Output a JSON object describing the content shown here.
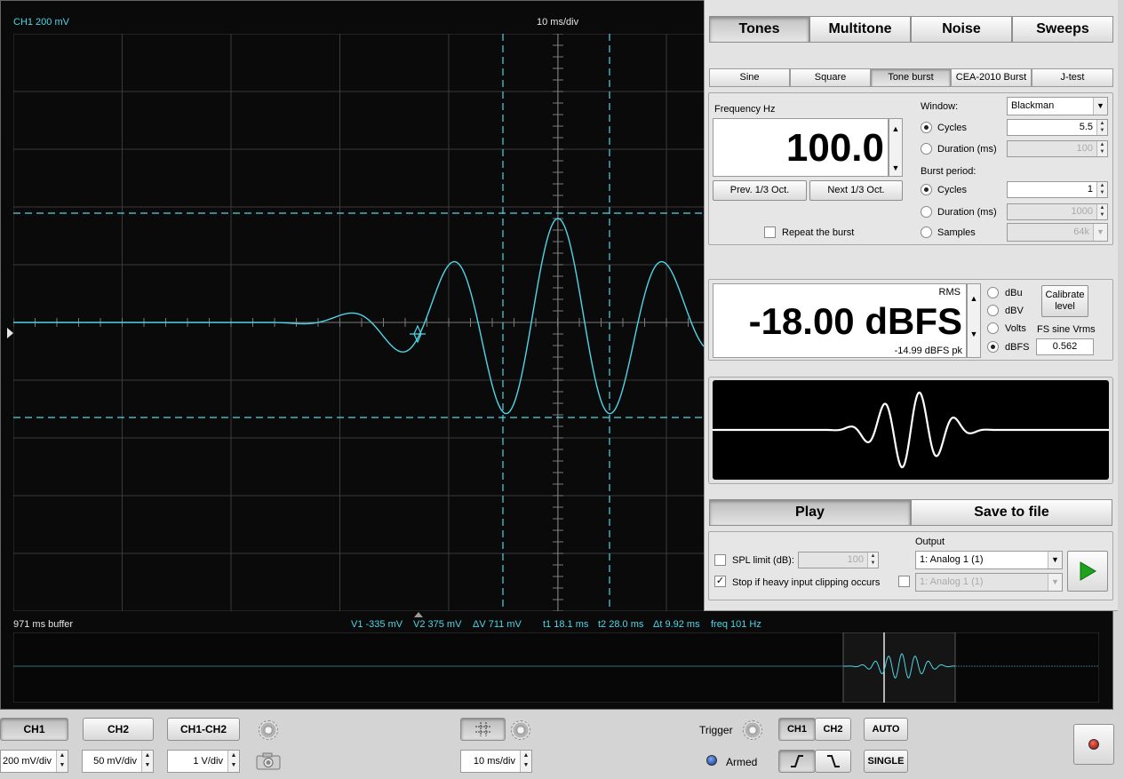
{
  "scope": {
    "ch1_label": "CH1 200 mV",
    "timebase_label": "10 ms/div",
    "buffer_label": "971 ms buffer",
    "measurements": {
      "v1": "V1 -335 mV",
      "v2": "V2 375 mV",
      "dv": "ΔV 711 mV",
      "t1": "t1 18.1 ms",
      "t2": "t2 28.0 ms",
      "dt": "Δt 9.92 ms",
      "freq": "freq 101 Hz"
    },
    "trace_color": "#4fd6e6"
  },
  "bottom": {
    "ch1": "CH1",
    "ch2": "CH2",
    "ch1_ch2": "CH1-CH2",
    "ch1_scale": "200 mV/div",
    "ch2_scale": "50 mV/div",
    "math_scale": "1 V/div",
    "time_scale": "10 ms/div",
    "trigger_label": "Trigger",
    "trig_ch1": "CH1",
    "trig_ch2": "CH2",
    "auto": "AUTO",
    "single": "SINGLE",
    "armed": "Armed"
  },
  "generator": {
    "tabs": [
      "Tones",
      "Multitone",
      "Noise",
      "Sweeps"
    ],
    "active_tab": "Tones",
    "subtabs": [
      "Sine",
      "Square",
      "Tone burst",
      "CEA-2010 Burst",
      "J-test"
    ],
    "active_subtab": "Tone burst",
    "frequency_label": "Frequency Hz",
    "frequency_value": "100.0",
    "prev_oct": "Prev. 1/3 Oct.",
    "next_oct": "Next 1/3 Oct.",
    "repeat_label": "Repeat the burst",
    "window_label": "Window:",
    "window_value": "Blackman",
    "cycles_label": "Cycles",
    "cycles_value": "5.5",
    "duration_label": "Duration (ms)",
    "duration_value": "100",
    "burst_period_label": "Burst period:",
    "bp_cycles_label": "Cycles",
    "bp_cycles_value": "1",
    "bp_duration_label": "Duration (ms)",
    "bp_duration_value": "1000",
    "samples_label": "Samples",
    "samples_value": "64k",
    "rms_label": "RMS",
    "level_value": "-18.00 dBFS",
    "peak_value": "-14.99 dBFS pk",
    "unit_dbu": "dBu",
    "unit_dbv": "dBV",
    "unit_volts": "Volts",
    "unit_dbfs": "dBFS",
    "calibrate_line1": "Calibrate",
    "calibrate_line2": "level",
    "fs_sine_label": "FS sine Vrms",
    "fs_sine_value": "0.562",
    "play": "Play",
    "save": "Save to file",
    "output_label": "Output",
    "spl_label": "SPL limit (dB):",
    "spl_value": "100",
    "stop_clip_label": "Stop if heavy input clipping occurs",
    "output1": "1: Analog 1 (1)",
    "output2": "1: Analog 1 (1)"
  }
}
